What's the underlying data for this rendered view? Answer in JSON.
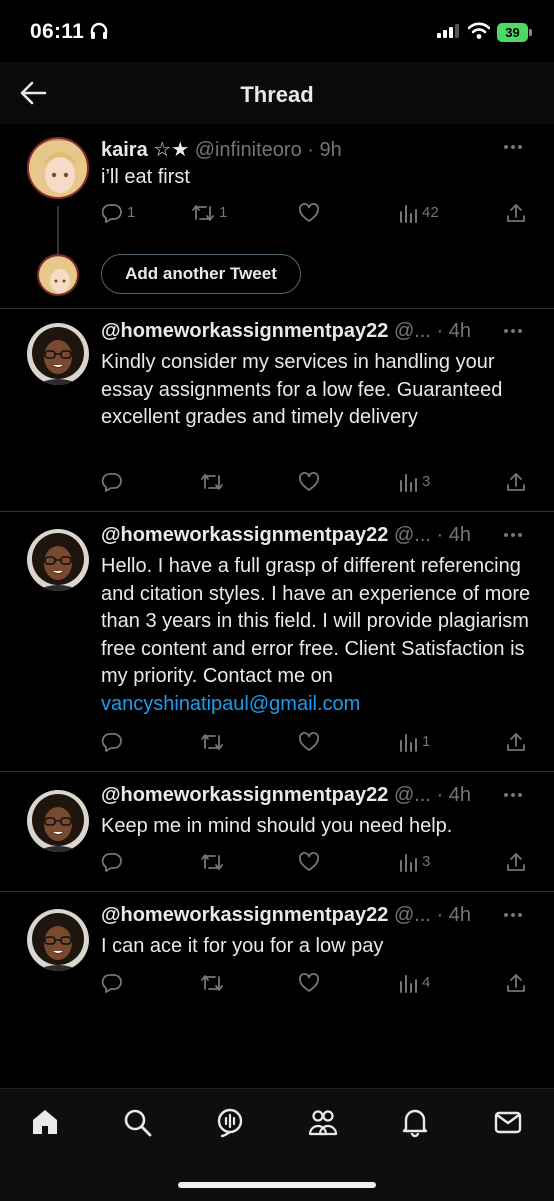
{
  "status_bar": {
    "time": "06:11",
    "battery": "39"
  },
  "header": {
    "title": "Thread"
  },
  "tweets": [
    {
      "author": "kaira ☆★",
      "handle": "@infiniteoro",
      "separator": "·",
      "time": "9h",
      "text": "i’ll eat first",
      "replies": "1",
      "retweets": "1",
      "views": "42"
    },
    {
      "author": "@homeworkassignmentpay22",
      "handle": "@...",
      "separator": "·",
      "time": "4h",
      "text": "Kindly consider my services in handling your essay assignments for a low fee. Guaranteed excellent grades and timely delivery",
      "views": "3"
    },
    {
      "author": "@homeworkassignmentpay22",
      "handle": "@...",
      "separator": "·",
      "time": "4h",
      "text": "Hello. I have a full grasp of different referencing and citation styles. I have an experience of more than 3 years in this field. I will provide plagiarism free content and error free. Client Satisfaction is my priority. Contact me on ",
      "link": "vancyshinatipaul@gmail.com",
      "views": "1"
    },
    {
      "author": "@homeworkassignmentpay22",
      "handle": "@...",
      "separator": "·",
      "time": "4h",
      "text": "Keep me in mind should you need help.",
      "views": "3"
    },
    {
      "author": "@homeworkassignmentpay22",
      "handle": "@...",
      "separator": "·",
      "time": "4h",
      "text": "I can ace it for you for a low pay",
      "views": "4"
    }
  ],
  "composer": {
    "add_label": "Add another Tweet"
  },
  "nav": [
    "home-icon",
    "search-icon",
    "spaces-icon",
    "communities-icon",
    "notifications-icon",
    "messages-icon"
  ],
  "colors": {
    "background": "#000000",
    "text": "#e7e9ea",
    "muted": "#71767b",
    "link": "#1d9bf0",
    "battery": "#4cd964"
  }
}
